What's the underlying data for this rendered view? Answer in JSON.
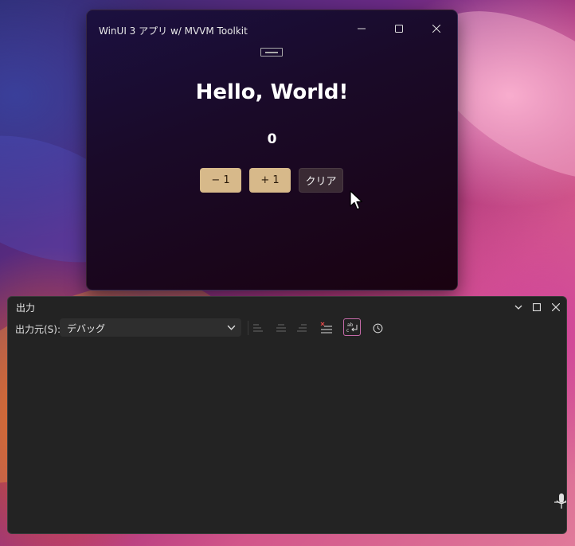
{
  "app": {
    "title": "WinUI 3 アプリ w/ MVVM Toolkit",
    "heading": "Hello, World!",
    "counter": "0",
    "buttons": {
      "decrement": "− 1",
      "increment": "+ 1",
      "clear": "クリア"
    },
    "colors": {
      "accent_button": "#d7b98a"
    }
  },
  "output": {
    "title": "出力",
    "source_label": "出力元(S):",
    "source_value": "デバッグ",
    "colors": {
      "word_wrap_active": "#c56aa8"
    }
  },
  "icons": {
    "app": [
      "minimize-icon",
      "maximize-icon",
      "close-icon",
      "drag-handle-icon",
      "mouse-pointer-icon"
    ],
    "output": [
      "chevron-down-icon",
      "maximize-icon",
      "close-icon",
      "align-left-icon",
      "align-center-icon",
      "align-right-icon",
      "clear-all-icon",
      "word-wrap-icon",
      "clock-icon"
    ]
  }
}
